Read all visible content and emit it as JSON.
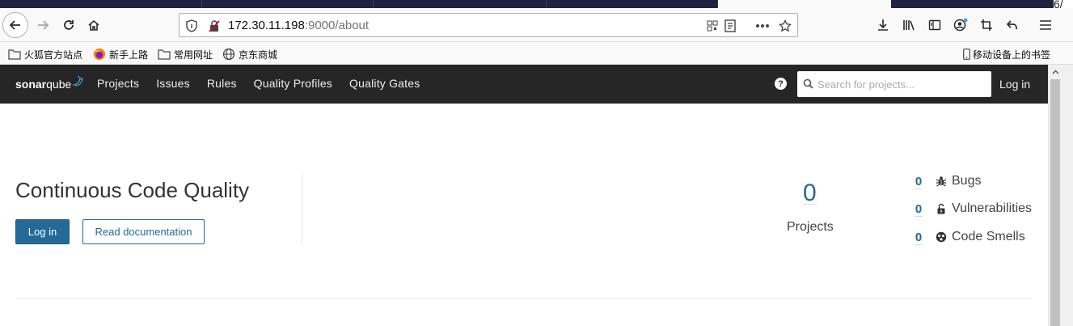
{
  "browser": {
    "url_host": "172.30.11.198",
    "url_rest": ":9000/about",
    "corner_text": "6/",
    "bookmarks": [
      {
        "label": "火狐官方站点",
        "icon": "folder-icon"
      },
      {
        "label": "新手上路",
        "icon": "firefox-icon"
      },
      {
        "label": "常用网址",
        "icon": "folder-icon"
      },
      {
        "label": "京东商城",
        "icon": "globe-icon"
      }
    ],
    "mobile_bookmarks": "移动设备上的书签"
  },
  "header": {
    "logo_bold": "sonar",
    "logo_light": "qube",
    "nav": [
      "Projects",
      "Issues",
      "Rules",
      "Quality Profiles",
      "Quality Gates"
    ],
    "search_placeholder": "Search for projects...",
    "login": "Log in"
  },
  "hero": {
    "title": "Continuous Code Quality",
    "login_button": "Log in",
    "docs_button": "Read documentation"
  },
  "stats": {
    "projects_count": "0",
    "projects_label": "Projects",
    "metrics": [
      {
        "value": "0",
        "label": "Bugs",
        "icon": "bug-icon"
      },
      {
        "value": "0",
        "label": "Vulnerabilities",
        "icon": "lock-icon"
      },
      {
        "value": "0",
        "label": "Code Smells",
        "icon": "code-smell-icon"
      }
    ]
  }
}
